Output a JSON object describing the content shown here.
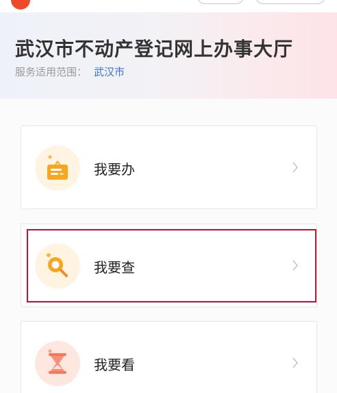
{
  "header": {
    "title": "武汉市不动产登记网上办事大厅",
    "scope_label": "服务适用范围：",
    "scope_value": "武汉市"
  },
  "menu": {
    "items": [
      {
        "label": "我要办",
        "icon": "clipboard-icon"
      },
      {
        "label": "我要查",
        "icon": "magnifier-icon"
      },
      {
        "label": "我要看",
        "icon": "hourglass-icon"
      }
    ]
  },
  "colors": {
    "accent_orange": "#f5a623",
    "highlight_red": "#c8102e",
    "link_blue": "#3d76c9"
  }
}
